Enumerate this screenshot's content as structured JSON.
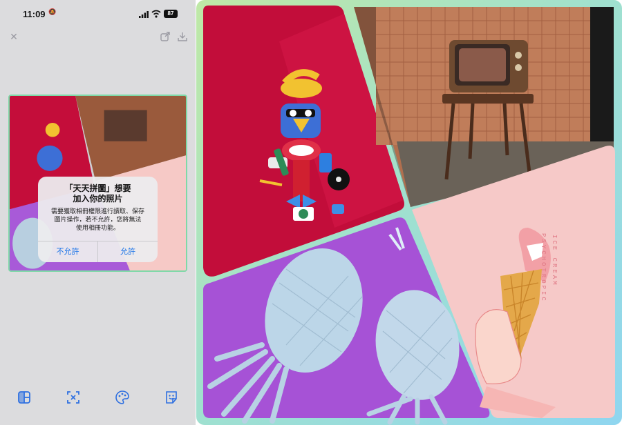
{
  "status_bar": {
    "time": "11:09",
    "battery": "87"
  },
  "dialog": {
    "title_line1": "「天天拼圖」想要",
    "title_line2": "加入你的照片",
    "message_line1": "需要獲取相冊權限進行讀取、保存",
    "message_line2": "圖片操作，若不允許，您將無法",
    "message_line3": "使用相冊功能。",
    "deny_label": "不允許",
    "allow_label": "允許",
    "accent_color": "#1a73e8"
  },
  "toolbar": {
    "items": [
      {
        "icon": "layout-icon"
      },
      {
        "icon": "crop-icon"
      },
      {
        "icon": "palette-icon"
      },
      {
        "icon": "sticker-icon"
      }
    ]
  },
  "collage": {
    "tiles": [
      "red-robot-illustration",
      "retro-tv-photo",
      "pineapples-photo",
      "ice-cream-shark-illustration"
    ],
    "text_vertical_1": "ICE CREAM",
    "text_vertical_2": "PSYCHOTROPIC",
    "border_color": "#9fe0c0"
  }
}
